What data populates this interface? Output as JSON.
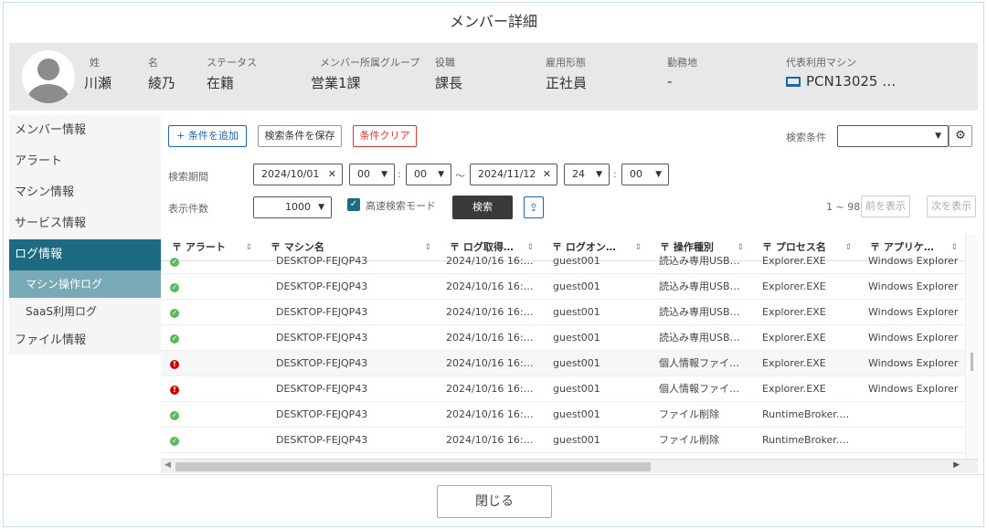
{
  "title": "メンバー詳細",
  "profile": {
    "sei_label": "姓",
    "sei": "川瀬",
    "mei_label": "名",
    "mei": "綾乃",
    "status_label": "ステータス",
    "status": "在籍",
    "group_label": "メンバー所属グループ",
    "group": "営業1課",
    "role_label": "役職",
    "role": "課長",
    "employment_label": "雇用形態",
    "employment": "正社員",
    "location_label": "勤務地",
    "location": "-",
    "machine_label": "代表利用マシン",
    "machine": "PCN13025 …"
  },
  "sidebar": {
    "items": [
      {
        "label": "メンバー情報"
      },
      {
        "label": "アラート"
      },
      {
        "label": "マシン情報"
      },
      {
        "label": "サービス情報"
      },
      {
        "label": "ログ情報"
      },
      {
        "label": "マシン操作ログ"
      },
      {
        "label": "SaaS利用ログ"
      },
      {
        "label": "ファイル情報"
      }
    ]
  },
  "toolbar": {
    "add_condition": "+ 条件を追加",
    "save_condition": "検索条件を保存",
    "clear_condition": "条件クリア",
    "search_condition_label": "検索条件",
    "search_condition_value": ""
  },
  "filters": {
    "period_label": "検索期間",
    "start_date": "2024/10/01",
    "start_hour": "00",
    "start_min": "00",
    "tilde": "～",
    "end_date": "2024/11/12",
    "end_hour": "24",
    "end_min": "00",
    "count_label": "表示件数",
    "count_value": "1000",
    "fast_mode_label": "高速検索モード",
    "search_button": "検索",
    "range_text": "1 ~ 98",
    "prev_button": "前を表示",
    "next_button": "次を表示"
  },
  "table": {
    "columns": [
      "アラート",
      "マシン名",
      "ログ取得…",
      "ログオン…",
      "操作種別",
      "プロセス名",
      "アプリケ…"
    ],
    "rows": [
      {
        "alert": "ok",
        "machine": "DESKTOP-FEJQP43",
        "time": "2024/10/16 16:…",
        "logon": "guest001",
        "op": "読込み専用USB…",
        "process": "Explorer.EXE",
        "app": "Windows Explorer"
      },
      {
        "alert": "ok",
        "machine": "DESKTOP-FEJQP43",
        "time": "2024/10/16 16:…",
        "logon": "guest001",
        "op": "読込み専用USB…",
        "process": "Explorer.EXE",
        "app": "Windows Explorer"
      },
      {
        "alert": "ok",
        "machine": "DESKTOP-FEJQP43",
        "time": "2024/10/16 16:…",
        "logon": "guest001",
        "op": "読込み専用USB…",
        "process": "Explorer.EXE",
        "app": "Windows Explorer"
      },
      {
        "alert": "ok",
        "machine": "DESKTOP-FEJQP43",
        "time": "2024/10/16 16:…",
        "logon": "guest001",
        "op": "読込み専用USB…",
        "process": "Explorer.EXE",
        "app": "Windows Explorer"
      },
      {
        "alert": "ng",
        "machine": "DESKTOP-FEJQP43",
        "time": "2024/10/16 16:…",
        "logon": "guest001",
        "op": "個人情報ファイ…",
        "process": "Explorer.EXE",
        "app": "Windows Explorer"
      },
      {
        "alert": "ng",
        "machine": "DESKTOP-FEJQP43",
        "time": "2024/10/16 16:…",
        "logon": "guest001",
        "op": "個人情報ファイ…",
        "process": "Explorer.EXE",
        "app": "Windows Explorer"
      },
      {
        "alert": "ok",
        "machine": "DESKTOP-FEJQP43",
        "time": "2024/10/16 16:…",
        "logon": "guest001",
        "op": "ファイル削除",
        "process": "RuntimeBroker.…",
        "app": ""
      },
      {
        "alert": "ok",
        "machine": "DESKTOP-FEJQP43",
        "time": "2024/10/16 16:…",
        "logon": "guest001",
        "op": "ファイル削除",
        "process": "RuntimeBroker.…",
        "app": ""
      }
    ]
  },
  "footer": {
    "close_button": "閉じる"
  },
  "colors": {
    "accent": "#1c6b82",
    "sub_active": "#78a9b6",
    "link_blue": "#1a66b3",
    "alert_red": "#cc0000",
    "ok_green": "#5cb85c"
  }
}
